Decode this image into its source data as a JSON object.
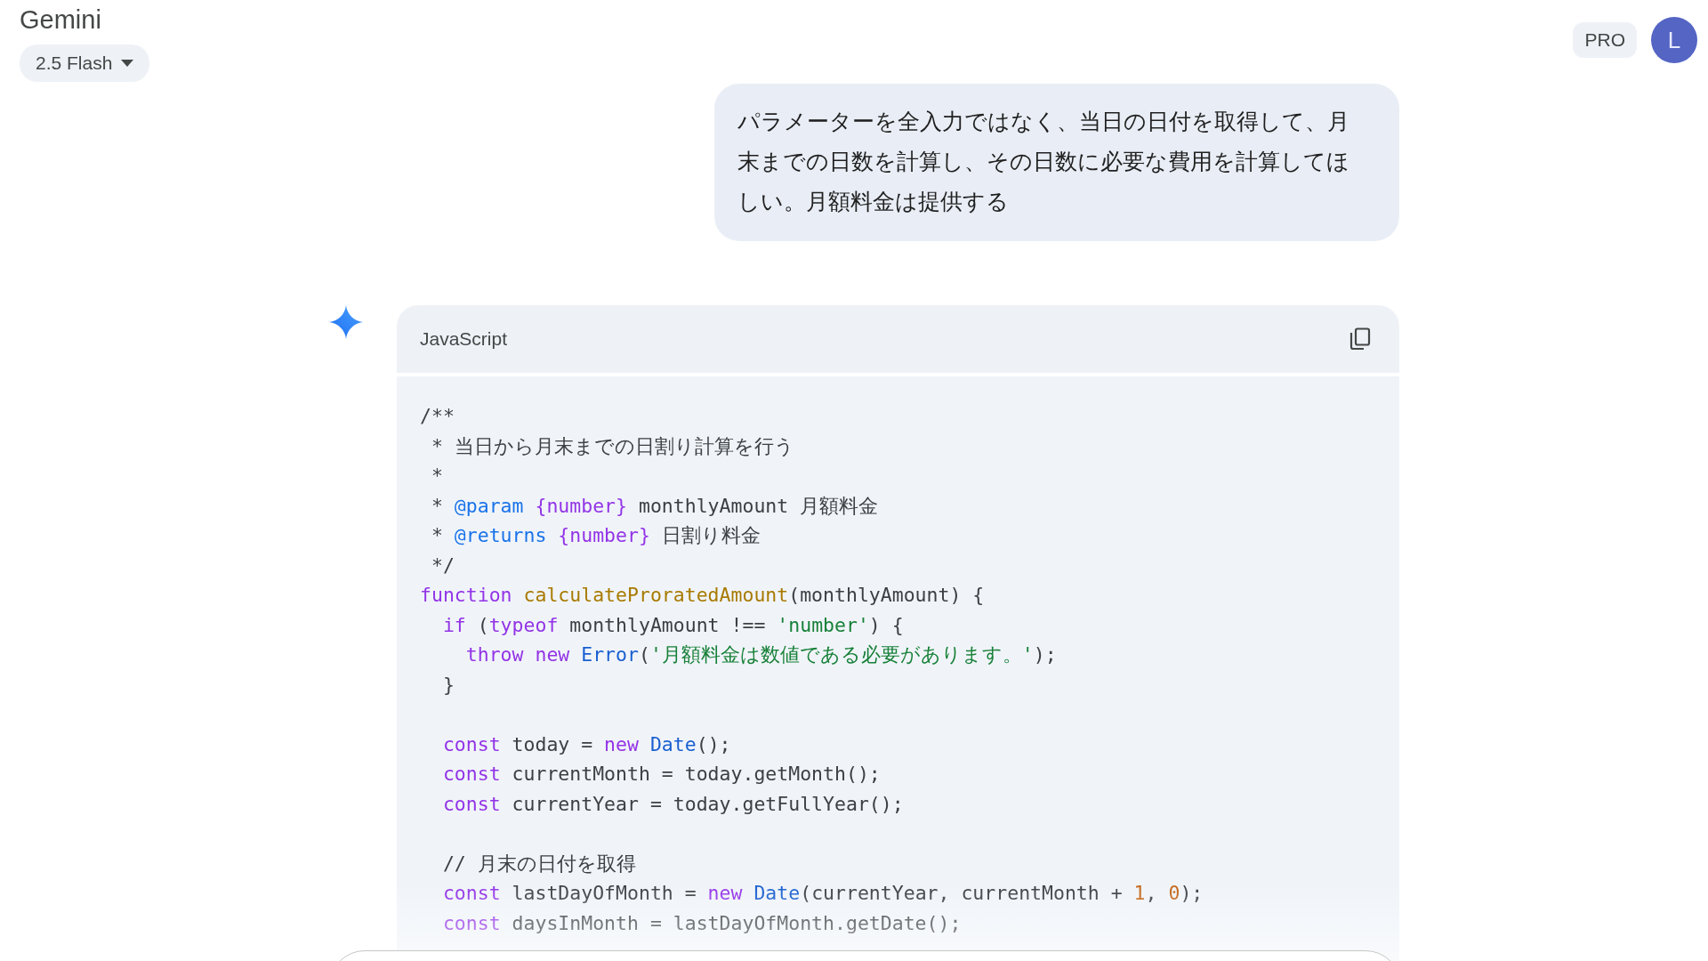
{
  "header": {
    "title": "Gemini",
    "model": "2.5 Flash",
    "plan_badge": "PRO",
    "avatar_letter": "L"
  },
  "user_message": "パラメーターを全入力ではなく、当日の日付を取得して、月末までの日数を計算し、その日数に必要な費用を計算してほしい。月額料金は提供する",
  "code_block": {
    "language": "JavaScript",
    "lines": [
      {
        "kind": "code",
        "tokens": [
          {
            "text": "/**",
            "kind": "plain"
          }
        ]
      },
      {
        "kind": "code",
        "tokens": [
          {
            "text": " * 当日から月末までの日割り計算を行う",
            "kind": "plain"
          }
        ]
      },
      {
        "kind": "code",
        "tokens": [
          {
            "text": " *",
            "kind": "plain"
          }
        ]
      },
      {
        "kind": "code",
        "tokens": [
          {
            "text": " *",
            "kind": "plain"
          },
          {
            "text": " @param",
            "kind": "tag"
          },
          {
            "text": " {number}",
            "kind": "type"
          },
          {
            "text": " monthlyAmount 月額料金",
            "kind": "plain"
          }
        ]
      },
      {
        "kind": "code",
        "tokens": [
          {
            "text": " *",
            "kind": "plain"
          },
          {
            "text": " @returns",
            "kind": "tag"
          },
          {
            "text": " {number}",
            "kind": "type"
          },
          {
            "text": " 日割り料金",
            "kind": "plain"
          }
        ]
      },
      {
        "kind": "code",
        "tokens": [
          {
            "text": " */",
            "kind": "plain"
          }
        ]
      },
      {
        "kind": "code",
        "tokens": [
          {
            "text": "function",
            "kind": "keyword"
          },
          {
            "text": " calculateProratedAmount",
            "kind": "function"
          },
          {
            "text": "(monthlyAmount) {",
            "kind": "plain"
          }
        ]
      },
      {
        "kind": "code",
        "tokens": [
          {
            "text": "  if",
            "kind": "keyword"
          },
          {
            "text": " (",
            "kind": "plain"
          },
          {
            "text": "typeof",
            "kind": "keyword"
          },
          {
            "text": " monthlyAmount !== ",
            "kind": "plain"
          },
          {
            "text": "'number'",
            "kind": "string"
          },
          {
            "text": ") {",
            "kind": "plain"
          }
        ]
      },
      {
        "kind": "code",
        "tokens": [
          {
            "text": "    throw",
            "kind": "keyword"
          },
          {
            "text": " new",
            "kind": "keyword"
          },
          {
            "text": " Error",
            "kind": "class"
          },
          {
            "text": "(",
            "kind": "plain"
          },
          {
            "text": "'月額料金は数値である必要があります。'",
            "kind": "string"
          },
          {
            "text": ");",
            "kind": "plain"
          }
        ]
      },
      {
        "kind": "code",
        "tokens": [
          {
            "text": "  }",
            "kind": "plain"
          }
        ]
      },
      {
        "kind": "blank"
      },
      {
        "kind": "code",
        "tokens": [
          {
            "text": "  const",
            "kind": "keyword"
          },
          {
            "text": " today = ",
            "kind": "plain"
          },
          {
            "text": "new",
            "kind": "keyword"
          },
          {
            "text": " Date",
            "kind": "class"
          },
          {
            "text": "();",
            "kind": "plain"
          }
        ]
      },
      {
        "kind": "code",
        "tokens": [
          {
            "text": "  const",
            "kind": "keyword"
          },
          {
            "text": " currentMonth = today.getMonth();",
            "kind": "plain"
          }
        ]
      },
      {
        "kind": "code",
        "tokens": [
          {
            "text": "  const",
            "kind": "keyword"
          },
          {
            "text": " currentYear = today.getFullYear();",
            "kind": "plain"
          }
        ]
      },
      {
        "kind": "blank"
      },
      {
        "kind": "code",
        "tokens": [
          {
            "text": "  // 月末の日付を取得",
            "kind": "plain"
          }
        ]
      },
      {
        "kind": "code",
        "tokens": [
          {
            "text": "  const",
            "kind": "keyword"
          },
          {
            "text": " lastDayOfMonth = ",
            "kind": "plain"
          },
          {
            "text": "new",
            "kind": "keyword"
          },
          {
            "text": " Date",
            "kind": "class"
          },
          {
            "text": "(currentYear, currentMonth + ",
            "kind": "plain"
          },
          {
            "text": "1",
            "kind": "number"
          },
          {
            "text": ", ",
            "kind": "plain"
          },
          {
            "text": "0",
            "kind": "number"
          },
          {
            "text": ");",
            "kind": "plain"
          }
        ]
      },
      {
        "kind": "code",
        "tokens": [
          {
            "text": "  const",
            "kind": "keyword"
          },
          {
            "text": " daysInMonth = lastDayOfMonth.getDate();",
            "kind": "plain"
          }
        ]
      }
    ]
  }
}
